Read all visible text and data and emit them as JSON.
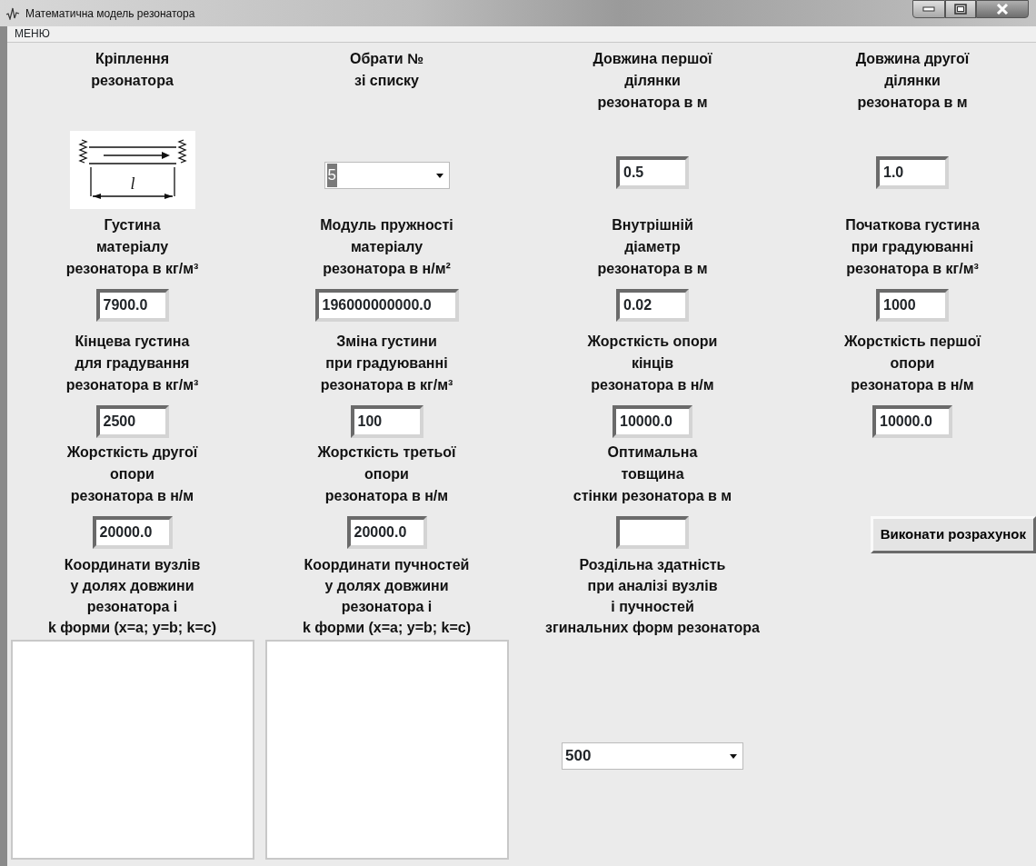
{
  "window": {
    "title": "Математична модель резонатора"
  },
  "menu": [
    "МЕНЮ"
  ],
  "cells": [
    {
      "kind": "image",
      "label": "Кріплення\nрезонатора",
      "diagram_label": "l"
    },
    {
      "kind": "combo",
      "label": "Обрати №\nзі списку",
      "value": "5",
      "highlighted": true
    },
    {
      "kind": "field",
      "label": "Довжина першої\nділянки\nрезонатора в м",
      "value": "0.5"
    },
    {
      "kind": "field",
      "label": "Довжина другої\nділянки\nрезонатора в м",
      "value": "1.0"
    },
    {
      "kind": "field",
      "label": "Густина\nматеріалу\nрезонатора в кг/м³",
      "value": "7900.0"
    },
    {
      "kind": "field",
      "label": "Модуль пружності\nматеріалу\nрезонатора в н/м²",
      "value": "196000000000.0"
    },
    {
      "kind": "field",
      "label": "Внутрішній\nдіаметр\nрезонатора в м",
      "value": "0.02"
    },
    {
      "kind": "field",
      "label": "Початкова густина\nпри градуюванні\nрезонатора в кг/м³",
      "value": "1000"
    },
    {
      "kind": "field",
      "label": "Кінцева густина\nдля градування\nрезонатора в  кг/м³",
      "value": "2500"
    },
    {
      "kind": "field",
      "label": "Зміна густини\nпри градуюванні\nрезонатора в кг/м³",
      "value": "100"
    },
    {
      "kind": "field",
      "label": "Жорсткість опори\nкінців\nрезонатора в н/м",
      "value": "10000.0"
    },
    {
      "kind": "field",
      "label": "Жорсткість першої\nопори\nрезонатора в н/м",
      "value": "10000.0"
    },
    {
      "kind": "field",
      "label": "Жорсткість другої\nопори\nрезонатора в н/м",
      "value": "20000.0"
    },
    {
      "kind": "field",
      "label": "Жорсткість третьої\nопори\nрезонатора в н/м",
      "value": "20000.0"
    },
    {
      "kind": "field",
      "label": "Оптимальна\nтовщина\nстінки резонатора в м"
    },
    {
      "kind": "button",
      "label": "Виконати розрахунок"
    },
    {
      "kind": "list",
      "label": "Координати вузлів\nу долях довжини\nрезонатора і\nk форми (x=a; y=b; k=c)"
    },
    {
      "kind": "list",
      "label": "Координати пучностей\nу долях довжини\nрезонатора і\nk форми (x=a; y=b; k=c)"
    },
    {
      "kind": "combo",
      "label": "Роздільна здатність\nпри аналізі вузлів\nі пучностей\nзгинальних форм резонатора",
      "value": "500",
      "highlighted": false
    }
  ]
}
